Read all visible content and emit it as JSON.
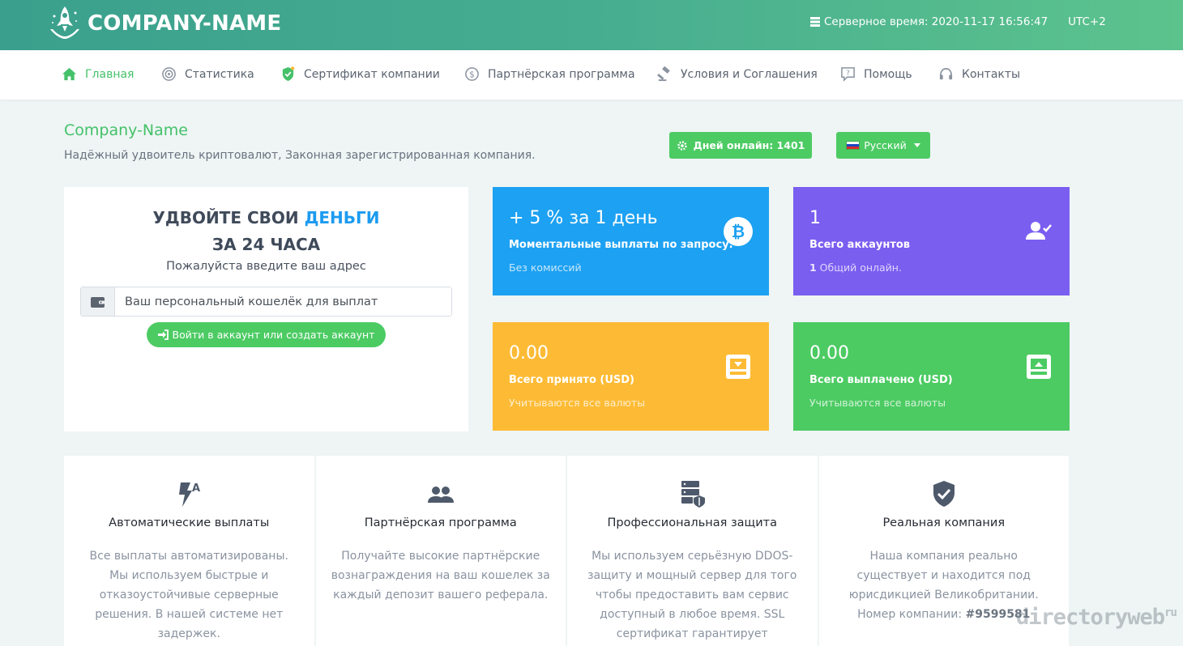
{
  "header": {
    "logo_text": "COMPANY-NAME",
    "server_time_label": "Серверное время: 2020-11-17 16:56:47",
    "timezone": "UTC+2"
  },
  "nav": {
    "items": [
      {
        "label": "Главная",
        "icon": "home-icon",
        "active": true
      },
      {
        "label": "Статистика",
        "icon": "target-icon"
      },
      {
        "label": "Сертификат компании",
        "icon": "shield-check-icon"
      },
      {
        "label": "Партнёрская программа",
        "icon": "dollar-circle-icon"
      },
      {
        "label": "Условия и Соглашения",
        "icon": "gavel-icon"
      },
      {
        "label": "Помощь",
        "icon": "help-bubble-icon"
      },
      {
        "label": "Контакты",
        "icon": "headphones-icon"
      }
    ]
  },
  "hero": {
    "title": "Company-Name",
    "subtitle": "Надёжный удвоитель криптовалют, Законная зарегистрированная компания.",
    "days_online": "Дней онлайн: 1401",
    "language": "Русский"
  },
  "double_card": {
    "heading_part1": "УДВОЙТЕ СВОИ ",
    "heading_highlight": "ДЕНЬГИ",
    "heading_line2": "ЗА 24 ЧАСА",
    "prompt": "Пожалуйста введите ваш адрес",
    "wallet_placeholder": "Ваш персональный кошелёк для выплат",
    "login_button": "Войти в аккаунт или создать аккаунт"
  },
  "stats": [
    {
      "value": "+ 5 % за 1 день",
      "label": "Моментальные выплаты по запросу.",
      "note": "Без комиссий",
      "color": "#1da1f2",
      "icon": "bitcoin-icon"
    },
    {
      "value": "1",
      "label": "Всего аккаунтов",
      "note_bold": "1",
      "note": " Общий онлайн.",
      "color": "#7a5ef0",
      "icon": "user-check-icon"
    },
    {
      "value": "0.00",
      "label": "Всего принято (USD)",
      "note": "Учитываются все валюты",
      "color": "#fdbb35",
      "icon": "inbox-download-icon"
    },
    {
      "value": "0.00",
      "label": "Всего выплачено (USD)",
      "note": "Учитываются все валюты",
      "color": "#4ccb63",
      "icon": "inbox-upload-icon"
    }
  ],
  "features": [
    {
      "title": "Автоматические выплаты",
      "text": "Все выплаты автоматизированы. Мы используем быстрые и отказоустойчивые серверные решения. В нашей системе нет задержек.",
      "icon": "auto-flash-icon"
    },
    {
      "title": "Партнёрская программа",
      "text": "Получайте высокие партнёрские вознаграждения на ваш кошелек за каждый депозит вашего реферала.",
      "icon": "users-icon"
    },
    {
      "title": "Профессиональная защита",
      "text": "Мы используем серьёзную DDOS-защиту и мощный сервер для того чтобы предоставить вам сервис доступный в любое время. SSL сертификат гарантирует",
      "icon": "server-shield-icon"
    },
    {
      "title": "Реальная компания",
      "text_prefix": "Наша компания реально существует и находится под юрисдикцией Великобритании. Номер компании: ",
      "text_bold": "#9599581",
      "icon": "shield-check-icon"
    }
  ],
  "watermark": {
    "text": "directoryweb",
    "sup": "ru"
  },
  "colors": {
    "accent_green": "#45c16a",
    "button_green": "#4ccb63",
    "blue": "#1da1f2",
    "purple": "#7a5ef0",
    "orange": "#fdbb35",
    "header_start": "#3aa08d",
    "header_end": "#5cc38d"
  }
}
